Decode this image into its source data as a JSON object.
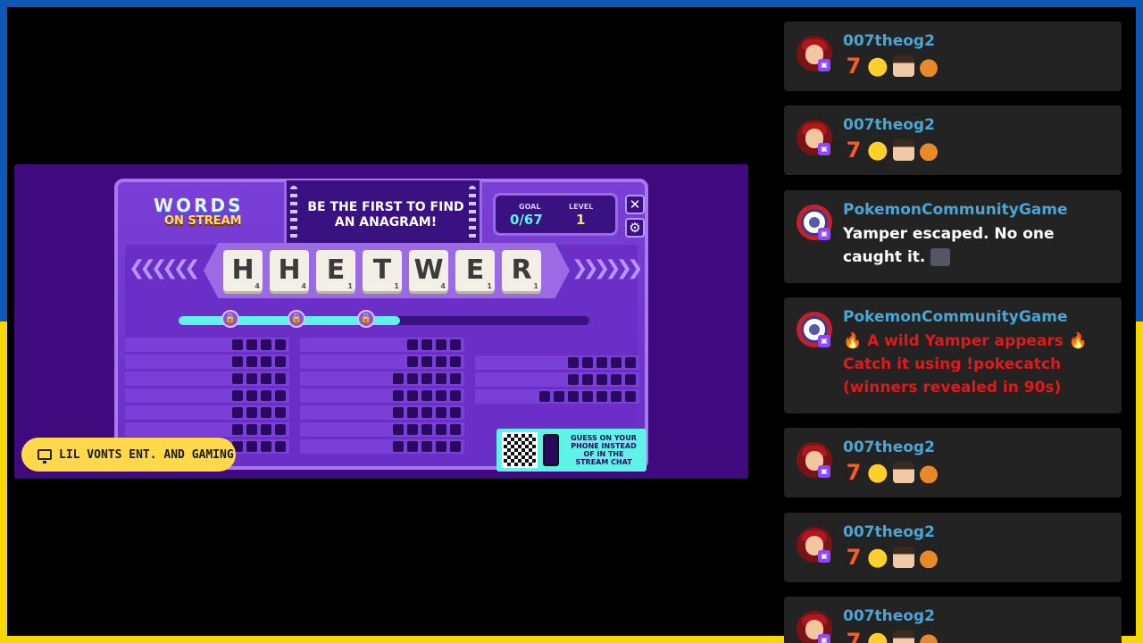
{
  "game": {
    "logo_words": "WORDS",
    "logo_on_stream": "ON STREAM",
    "banner": "BE THE FIRST TO FIND AN ANAGRAM!",
    "goal_label": "GOAL",
    "goal_value": "0/67",
    "level_label": "LEVEL",
    "level_value": "1",
    "close_icon": "close-icon",
    "settings_icon": "gear-icon",
    "tiles": [
      {
        "letter": "H",
        "points": "4"
      },
      {
        "letter": "H",
        "points": "4"
      },
      {
        "letter": "E",
        "points": "1"
      },
      {
        "letter": "T",
        "points": "1"
      },
      {
        "letter": "W",
        "points": "4"
      },
      {
        "letter": "E",
        "points": "1"
      },
      {
        "letter": "R",
        "points": "1"
      }
    ],
    "progress_fraction": 0.54,
    "qr_text_1": "GUESS ON YOUR PHONE INSTEAD OF IN THE STREAM CHAT",
    "colors": {
      "accent_cyan": "#5ff2e6",
      "board_purple": "#6b2fc7"
    }
  },
  "channel": {
    "name": "LIL VONTS ENT. AND GAMING",
    "icon": "monitor-icon"
  },
  "chat": [
    {
      "user": "007theog2",
      "type": "emotes"
    },
    {
      "user": "007theog2",
      "type": "emotes"
    },
    {
      "user": "PokemonCommunityGame",
      "type": "text",
      "text": "Yamper escaped. No one caught it."
    },
    {
      "user": "PokemonCommunityGame",
      "type": "red",
      "line1": "A wild Yamper appears",
      "line2": "Catch it using !pokecatch",
      "line3": "(winners revealed in 90s)"
    },
    {
      "user": "007theog2",
      "type": "emotes"
    },
    {
      "user": "007theog2",
      "type": "emotes"
    },
    {
      "user": "007theog2",
      "type": "emotes"
    }
  ],
  "emote_seven": "7"
}
